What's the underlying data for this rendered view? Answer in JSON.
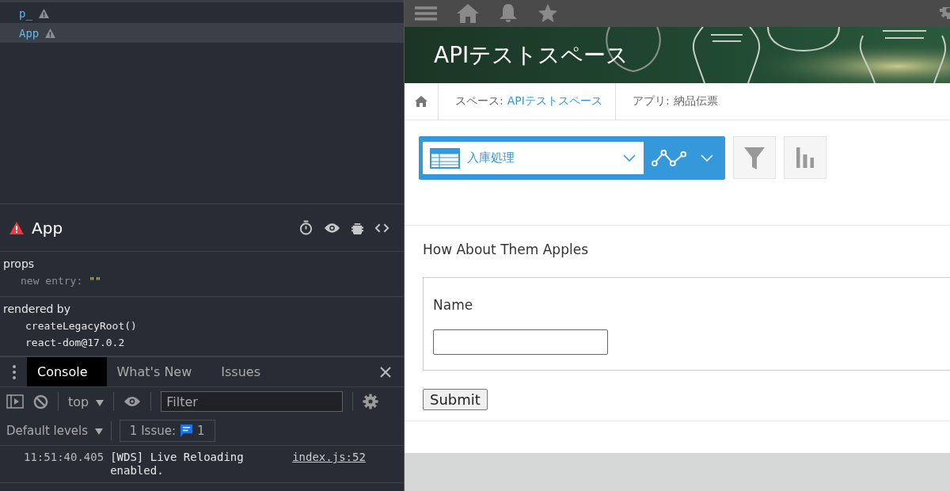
{
  "components_tree": [
    {
      "name": "p_",
      "selected": false,
      "warning": true
    },
    {
      "name": "App",
      "selected": true,
      "warning": true
    }
  ],
  "inspected_component": {
    "name": "App",
    "error": true,
    "props_heading": "props",
    "props": [
      {
        "key": "new entry:",
        "value": "\"\""
      }
    ],
    "rendered_by_heading": "rendered by",
    "rendered_by": [
      "createLegacyRoot()",
      "react-dom@17.0.2"
    ]
  },
  "drawer": {
    "tabs": [
      {
        "label": "Console",
        "selected": true
      },
      {
        "label": "What's New",
        "selected": false
      },
      {
        "label": "Issues",
        "selected": false
      }
    ],
    "context": "top",
    "filter_placeholder": "Filter",
    "levels": "Default levels",
    "issues_label": "1 Issue:",
    "issues_count": "1",
    "messages": [
      {
        "time": "11:51:40.405",
        "text": "[WDS] Live Reloading enabled.",
        "source": "index.js:52"
      }
    ]
  },
  "space": {
    "title": "APIテストスペース"
  },
  "breadcrumb": [
    {
      "label": "スペース: ",
      "value": "APIテストスペース",
      "link": true
    },
    {
      "label": "アプリ: ",
      "value": "納品伝票",
      "link": false
    }
  ],
  "view_selector": {
    "label": "入庫処理"
  },
  "form": {
    "title": "How About Them Apples",
    "field_label": "Name",
    "submit": "Submit"
  }
}
